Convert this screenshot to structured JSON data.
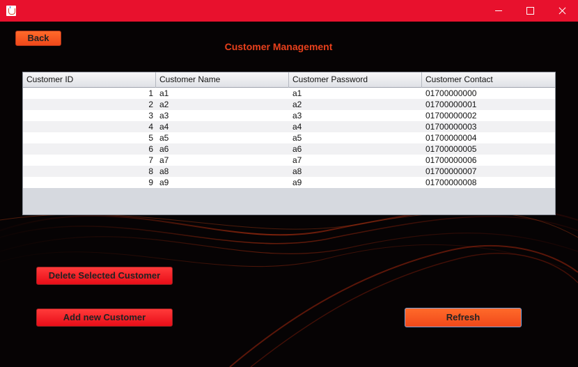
{
  "window": {
    "icon": "java-cup-icon",
    "minimize_icon": "minimize-icon",
    "maximize_icon": "maximize-icon",
    "close_icon": "close-icon",
    "titlebar_color": "#e8112d"
  },
  "toolbar": {
    "back_label": "Back"
  },
  "page": {
    "title": "Customer Management",
    "title_color": "#e8401c"
  },
  "table": {
    "columns": [
      "Customer ID",
      "Customer Name",
      "Customer Password",
      "Customer Contact"
    ],
    "rows": [
      [
        "1",
        "a1",
        "a1",
        "01700000000"
      ],
      [
        "2",
        "a2",
        "a2",
        "01700000001"
      ],
      [
        "3",
        "a3",
        "a3",
        "01700000002"
      ],
      [
        "4",
        "a4",
        "a4",
        "01700000003"
      ],
      [
        "5",
        "a5",
        "a5",
        "01700000004"
      ],
      [
        "6",
        "a6",
        "a6",
        "01700000005"
      ],
      [
        "7",
        "a7",
        "a7",
        "01700000006"
      ],
      [
        "8",
        "a8",
        "a8",
        "01700000007"
      ],
      [
        "9",
        "a9",
        "a9",
        "01700000008"
      ]
    ]
  },
  "actions": {
    "delete_label": "Delete Selected Customer",
    "add_label": "Add new Customer",
    "refresh_label": "Refresh"
  },
  "colors": {
    "accent_orange": "#f0481a",
    "accent_red": "#e80d18",
    "background": "#060304"
  }
}
